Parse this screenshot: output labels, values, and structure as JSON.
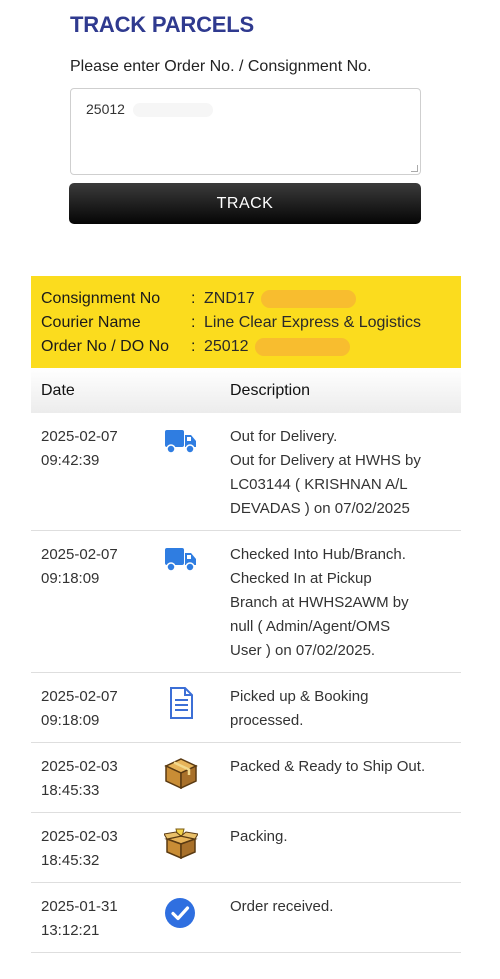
{
  "header": {
    "title": "TRACK PARCELS",
    "prompt": "Please enter Order No. / Consignment No."
  },
  "search": {
    "value": "25012",
    "button_label": "TRACK"
  },
  "consignment": {
    "consignment_label": "Consignment No",
    "consignment_value": "ZND17",
    "courier_label": "Courier Name",
    "courier_value": "Line Clear Express & Logistics",
    "order_label": "Order No / DO No",
    "order_value": "25012",
    "separator": ":"
  },
  "table": {
    "col_date": "Date",
    "col_description": "Description",
    "rows": [
      {
        "date": "2025-02-07",
        "time": "09:42:39",
        "icon": "truck-icon",
        "lines": [
          "Out for Delivery.",
          "Out for Delivery at HWHS by",
          "LC03144 ( KRISHNAN A/L",
          "DEVADAS ) on 07/02/2025"
        ]
      },
      {
        "date": "2025-02-07",
        "time": "09:18:09",
        "icon": "truck-icon",
        "lines": [
          "Checked Into Hub/Branch.",
          "Checked In at Pickup",
          "Branch at HWHS2AWM by",
          "null ( Admin/Agent/OMS",
          "User ) on 07/02/2025."
        ]
      },
      {
        "date": "2025-02-07",
        "time": "09:18:09",
        "icon": "document-icon",
        "lines": [
          "Picked up & Booking",
          "processed."
        ]
      },
      {
        "date": "2025-02-03",
        "time": "18:45:33",
        "icon": "package-icon",
        "lines": [
          "Packed & Ready to Ship Out."
        ]
      },
      {
        "date": "2025-02-03",
        "time": "18:45:32",
        "icon": "open-box-icon",
        "lines": [
          "Packing."
        ]
      },
      {
        "date": "2025-01-31",
        "time": "13:12:21",
        "icon": "check-circle-icon",
        "lines": [
          "Order received."
        ]
      }
    ]
  },
  "colors": {
    "title": "#2f3a8f",
    "panel": "#fbdc1e",
    "truck": "#2f7de1",
    "check": "#2f6fe0",
    "box": "#b07a2a"
  }
}
